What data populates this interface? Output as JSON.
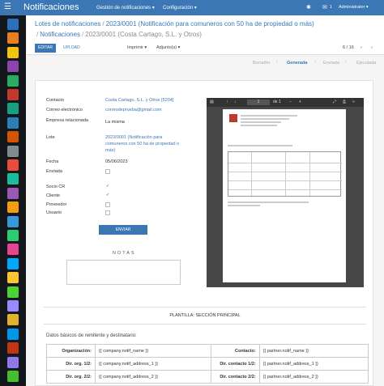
{
  "topbar": {
    "app_title": "Notificaciones",
    "menu": [
      "Gestión de notificaciones ▾",
      "Configuración ▾"
    ],
    "messages_count": "1",
    "user": "Administrator ▾"
  },
  "breadcrumb": {
    "items": [
      "Lotes de notificaciones",
      "2023/0001 (Notificación para comuneros con 50 ha de propiedad o más)",
      "Notificaciones"
    ],
    "current": "2023/0001 (Costa Cartago, S.L. y Otros)"
  },
  "toolbar": {
    "edit_label": "EDITAR",
    "upload_label": "UPLOAD",
    "print_label": "Imprimir ▾",
    "attachments_label": "Adjunto(s) ▾",
    "pager": "6 / 16"
  },
  "stages": {
    "items": [
      "Borrador",
      "Generada",
      "Enviada",
      "Ejecutada"
    ],
    "active": "Generada"
  },
  "form": {
    "contacto_label": "Contacto",
    "contacto_value": "Costa Cartago, S.L. y Otros [5204]",
    "email_label": "Correo electrónico",
    "email_value": "correodeprueba@gmail.com",
    "empresa_label": "Empresa relacionada",
    "empresa_value": "La misma",
    "lote_label": "Lote",
    "lote_value_1": "2023/0001 (Notificación para",
    "lote_value_2": "comuneros con 50 ha de propiedad o",
    "lote_value_3": "más)",
    "fecha_label": "Fecha",
    "fecha_value": "05/06/2023",
    "enviada_label": "Enviada",
    "socio_label": "Socio CR",
    "cliente_label": "Cliente",
    "proveedor_label": "Proveedor",
    "usuario_label": "Usuario",
    "send_button": "ENVIAR",
    "notes_label": "NOTAS"
  },
  "pdf_viewer": {
    "page_input": "1",
    "page_total": "de 1"
  },
  "template": {
    "title": "PLANTILLA: SECCIÓN PRINCIPAL",
    "basic_title": "Datos básicos de remitente y destinatario:",
    "rows": [
      {
        "l1": "Organización:",
        "v1": "{{ company.notif_name }}",
        "l2": "Contacto:",
        "v2": "{{ partner.notif_name }}"
      },
      {
        "l1": "Dir. org. 1/2:",
        "v1": "{{ company.notif_address_1 }}",
        "l2": "Dir. contacto 1/2:",
        "v2": "{{ partner.notif_address_1 }}"
      },
      {
        "l1": "Dir. org. 2/2:",
        "v1": "{{ company.notif_address_2 }}",
        "l2": "Dir. contacto 2/2:",
        "v2": "{{ partner.notif_address_2 }}"
      }
    ]
  },
  "colors": {
    "brand": "#3a77b4",
    "sidebar_bg": "#14171c"
  },
  "sidebar_icons": [
    "app-icon-1",
    "app-icon-2",
    "app-icon-3",
    "app-icon-4",
    "app-icon-5",
    "app-icon-6",
    "app-icon-7",
    "app-icon-8",
    "app-icon-9",
    "app-icon-10",
    "app-icon-11",
    "app-icon-12",
    "app-icon-13",
    "app-icon-14",
    "app-icon-15",
    "app-icon-16",
    "app-icon-17",
    "app-icon-18",
    "app-icon-19",
    "app-icon-20",
    "app-icon-21",
    "app-icon-22",
    "app-icon-23",
    "app-icon-24",
    "app-icon-25",
    "app-icon-26"
  ]
}
